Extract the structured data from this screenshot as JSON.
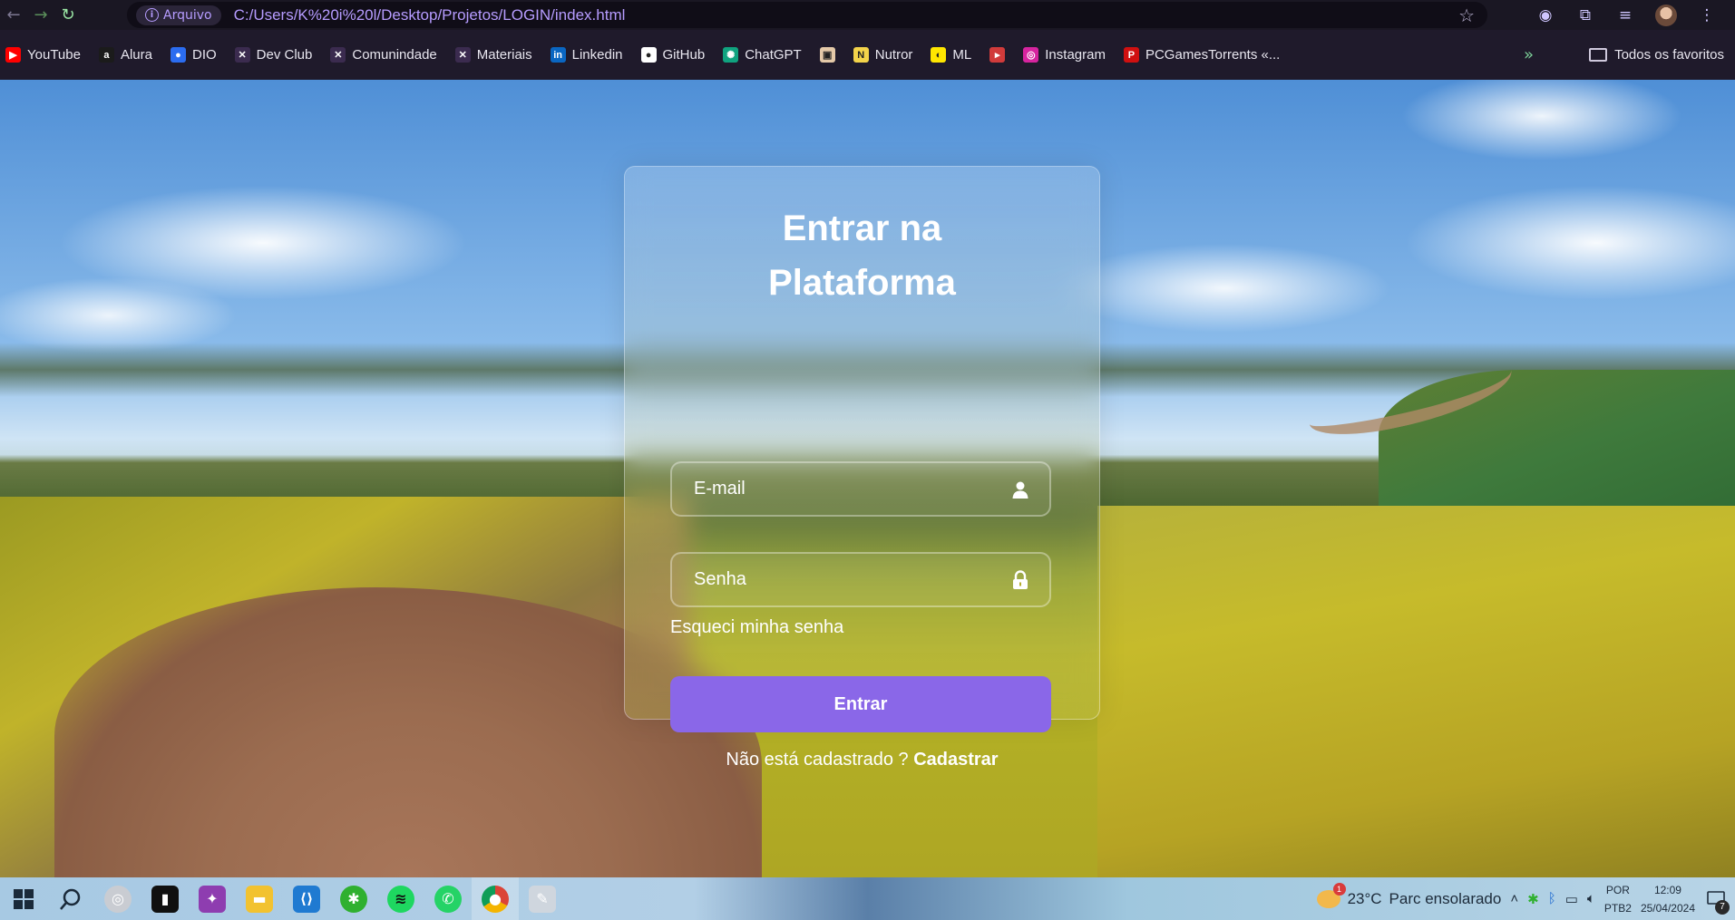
{
  "browser": {
    "address_chip": "Arquivo",
    "url": "C:/Users/K%20i%20l/Desktop/Projetos/LOGIN/index.html"
  },
  "bookmarks": [
    {
      "label": "YouTube",
      "color": "#ff0000",
      "glyph": "▶"
    },
    {
      "label": "Alura",
      "color": "#1b1b1b",
      "glyph": "a"
    },
    {
      "label": "DIO",
      "color": "#2b6cf0",
      "glyph": "●"
    },
    {
      "label": "Dev Club",
      "color": "#3b2b4f",
      "glyph": "✕"
    },
    {
      "label": "Comunindade",
      "color": "#3b2b4f",
      "glyph": "✕"
    },
    {
      "label": "Materiais",
      "color": "#3b2b4f",
      "glyph": "✕"
    },
    {
      "label": "Linkedin",
      "color": "#0a66c2",
      "glyph": "in"
    },
    {
      "label": "GitHub",
      "color": "#ffffff",
      "glyph": "●"
    },
    {
      "label": "ChatGPT",
      "color": "#10a37f",
      "glyph": "✺"
    },
    {
      "label": "",
      "color": "#e4c9a8",
      "glyph": "▣"
    },
    {
      "label": "Nutror",
      "color": "#f3d34a",
      "glyph": "N"
    },
    {
      "label": "ML",
      "color": "#ffe600",
      "glyph": "◐"
    },
    {
      "label": "",
      "color": "#d13b3b",
      "glyph": "▸"
    },
    {
      "label": "Instagram",
      "color": "#d6249f",
      "glyph": "◎"
    },
    {
      "label": "PCGamesTorrents «...",
      "color": "#d01010",
      "glyph": "P"
    }
  ],
  "bookmarks_all": "Todos os favoritos",
  "login": {
    "title_line1": "Entrar na",
    "title_line2": "Plataforma",
    "email_placeholder": "E-mail",
    "password_placeholder": "Senha",
    "forgot": "Esqueci minha senha",
    "submit": "Entrar",
    "register_text": "Não está cadastrado ? ",
    "register_link": "Cadastrar",
    "accent_color": "#8a67e8"
  },
  "taskbar": {
    "weather_badge": "1",
    "weather_temp": "23°C",
    "weather_desc": "Parc ensolarado",
    "lang_line1": "POR",
    "lang_line2": "PTB2",
    "time": "12:09",
    "date": "25/04/2024",
    "notifications": "7"
  }
}
